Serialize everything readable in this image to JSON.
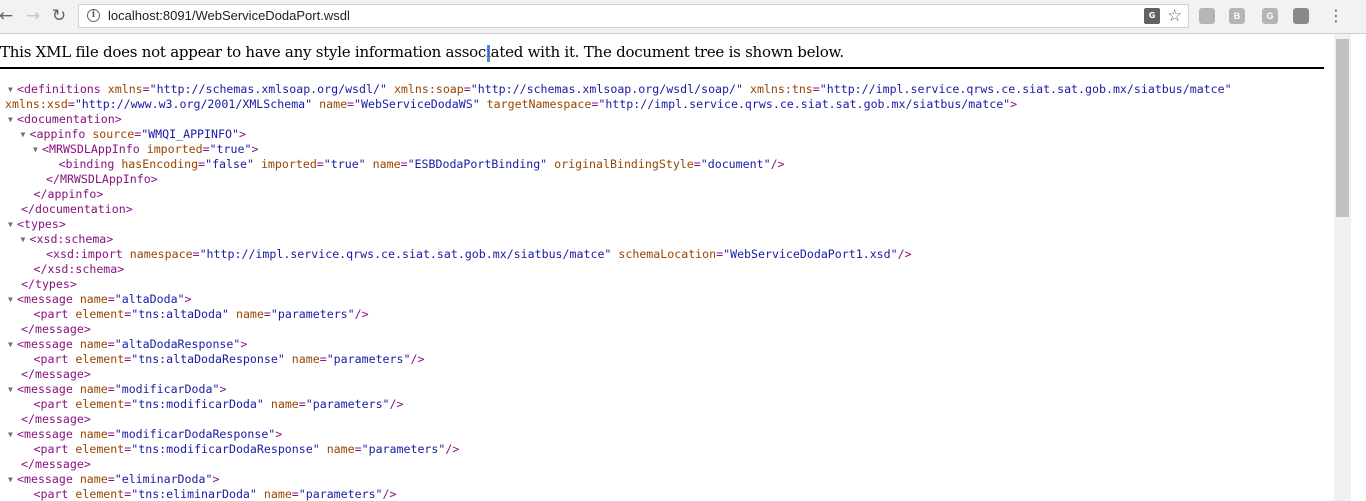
{
  "browser": {
    "url": "localhost:8091/WebServiceDodaPort.wsdl",
    "icons": {
      "back": "arrow-left-icon",
      "forward": "arrow-right-icon",
      "reload": "reload-icon",
      "info": "info-icon",
      "translate": "translate-icon",
      "star": "star-icon",
      "menu": "kebab-menu-icon"
    },
    "extensions": [
      "B",
      "G"
    ]
  },
  "page": {
    "info_message": "This XML file does not appear to have any style information associated with it. The document tree is shown below."
  },
  "colors": {
    "tag": "#881280",
    "attribute_name": "#994500",
    "attribute_value": "#1a1aa6",
    "toggle": "#6e6e6e"
  },
  "xml_lines": [
    {
      "indent": 0,
      "toggle": true,
      "tag": "<definitions",
      "attrs": [
        [
          "xmlns",
          "\"http://schemas.xmlsoap.org/wsdl/\""
        ],
        [
          "xmlns:soap",
          "\"http://schemas.xmlsoap.org/wsdl/soap/\""
        ],
        [
          "xmlns:tns",
          "\"http://impl.service.qrws.ce.siat.sat.gob.mx/siatbus/matce\""
        ]
      ],
      "end": ""
    },
    {
      "indent": 0,
      "toggle": false,
      "tag": "",
      "attrs": [
        [
          "xmlns:xsd",
          "\"http://www.w3.org/2001/XMLSchema\""
        ],
        [
          "name",
          "\"WebServiceDodaWS\""
        ],
        [
          "targetNamespace",
          "\"http://impl.service.qrws.ce.siat.sat.gob.mx/siatbus/matce\""
        ]
      ],
      "end": ">"
    },
    {
      "indent": 0,
      "toggle": true,
      "tag": "<documentation",
      "attrs": [],
      "end": ">"
    },
    {
      "indent": 1,
      "toggle": true,
      "tag": "<appinfo",
      "attrs": [
        [
          "source",
          "\"WMQI_APPINFO\""
        ]
      ],
      "end": ">"
    },
    {
      "indent": 2,
      "toggle": true,
      "tag": "<MRWSDLAppInfo",
      "attrs": [
        [
          "imported",
          "\"true\""
        ]
      ],
      "end": ">"
    },
    {
      "indent": 3,
      "toggle": false,
      "tag": "<binding",
      "attrs": [
        [
          "hasEncoding",
          "\"false\""
        ],
        [
          "imported",
          "\"true\""
        ],
        [
          "name",
          "\"ESBDodaPortBinding\""
        ],
        [
          "originalBindingStyle",
          "\"document\""
        ]
      ],
      "end": "/>"
    },
    {
      "indent": 2,
      "toggle": false,
      "tag": "</MRWSDLAppInfo>",
      "attrs": [],
      "end": ""
    },
    {
      "indent": 1,
      "toggle": false,
      "tag": "</appinfo>",
      "attrs": [],
      "end": ""
    },
    {
      "indent": 0,
      "toggle": false,
      "tag": "</documentation>",
      "attrs": [],
      "end": ""
    },
    {
      "indent": 0,
      "toggle": true,
      "tag": "<types",
      "attrs": [],
      "end": ">"
    },
    {
      "indent": 1,
      "toggle": true,
      "tag": "<xsd:schema",
      "attrs": [],
      "end": ">"
    },
    {
      "indent": 2,
      "toggle": false,
      "tag": "<xsd:import",
      "attrs": [
        [
          "namespace",
          "\"http://impl.service.qrws.ce.siat.sat.gob.mx/siatbus/matce\""
        ],
        [
          "schemaLocation",
          "\"WebServiceDodaPort1.xsd\""
        ]
      ],
      "end": "/>"
    },
    {
      "indent": 1,
      "toggle": false,
      "tag": "</xsd:schema>",
      "attrs": [],
      "end": ""
    },
    {
      "indent": 0,
      "toggle": false,
      "tag": "</types>",
      "attrs": [],
      "end": ""
    },
    {
      "indent": 0,
      "toggle": true,
      "tag": "<message",
      "attrs": [
        [
          "name",
          "\"altaDoda\""
        ]
      ],
      "end": ">"
    },
    {
      "indent": 1,
      "toggle": false,
      "tag": "<part",
      "attrs": [
        [
          "element",
          "\"tns:altaDoda\""
        ],
        [
          "name",
          "\"parameters\""
        ]
      ],
      "end": "/>"
    },
    {
      "indent": 0,
      "toggle": false,
      "tag": "</message>",
      "attrs": [],
      "end": ""
    },
    {
      "indent": 0,
      "toggle": true,
      "tag": "<message",
      "attrs": [
        [
          "name",
          "\"altaDodaResponse\""
        ]
      ],
      "end": ">"
    },
    {
      "indent": 1,
      "toggle": false,
      "tag": "<part",
      "attrs": [
        [
          "element",
          "\"tns:altaDodaResponse\""
        ],
        [
          "name",
          "\"parameters\""
        ]
      ],
      "end": "/>"
    },
    {
      "indent": 0,
      "toggle": false,
      "tag": "</message>",
      "attrs": [],
      "end": ""
    },
    {
      "indent": 0,
      "toggle": true,
      "tag": "<message",
      "attrs": [
        [
          "name",
          "\"modificarDoda\""
        ]
      ],
      "end": ">"
    },
    {
      "indent": 1,
      "toggle": false,
      "tag": "<part",
      "attrs": [
        [
          "element",
          "\"tns:modificarDoda\""
        ],
        [
          "name",
          "\"parameters\""
        ]
      ],
      "end": "/>"
    },
    {
      "indent": 0,
      "toggle": false,
      "tag": "</message>",
      "attrs": [],
      "end": ""
    },
    {
      "indent": 0,
      "toggle": true,
      "tag": "<message",
      "attrs": [
        [
          "name",
          "\"modificarDodaResponse\""
        ]
      ],
      "end": ">"
    },
    {
      "indent": 1,
      "toggle": false,
      "tag": "<part",
      "attrs": [
        [
          "element",
          "\"tns:modificarDodaResponse\""
        ],
        [
          "name",
          "\"parameters\""
        ]
      ],
      "end": "/>"
    },
    {
      "indent": 0,
      "toggle": false,
      "tag": "</message>",
      "attrs": [],
      "end": ""
    },
    {
      "indent": 0,
      "toggle": true,
      "tag": "<message",
      "attrs": [
        [
          "name",
          "\"eliminarDoda\""
        ]
      ],
      "end": ">"
    },
    {
      "indent": 1,
      "toggle": false,
      "tag": "<part",
      "attrs": [
        [
          "element",
          "\"tns:eliminarDoda\""
        ],
        [
          "name",
          "\"parameters\""
        ]
      ],
      "end": "/>"
    }
  ]
}
